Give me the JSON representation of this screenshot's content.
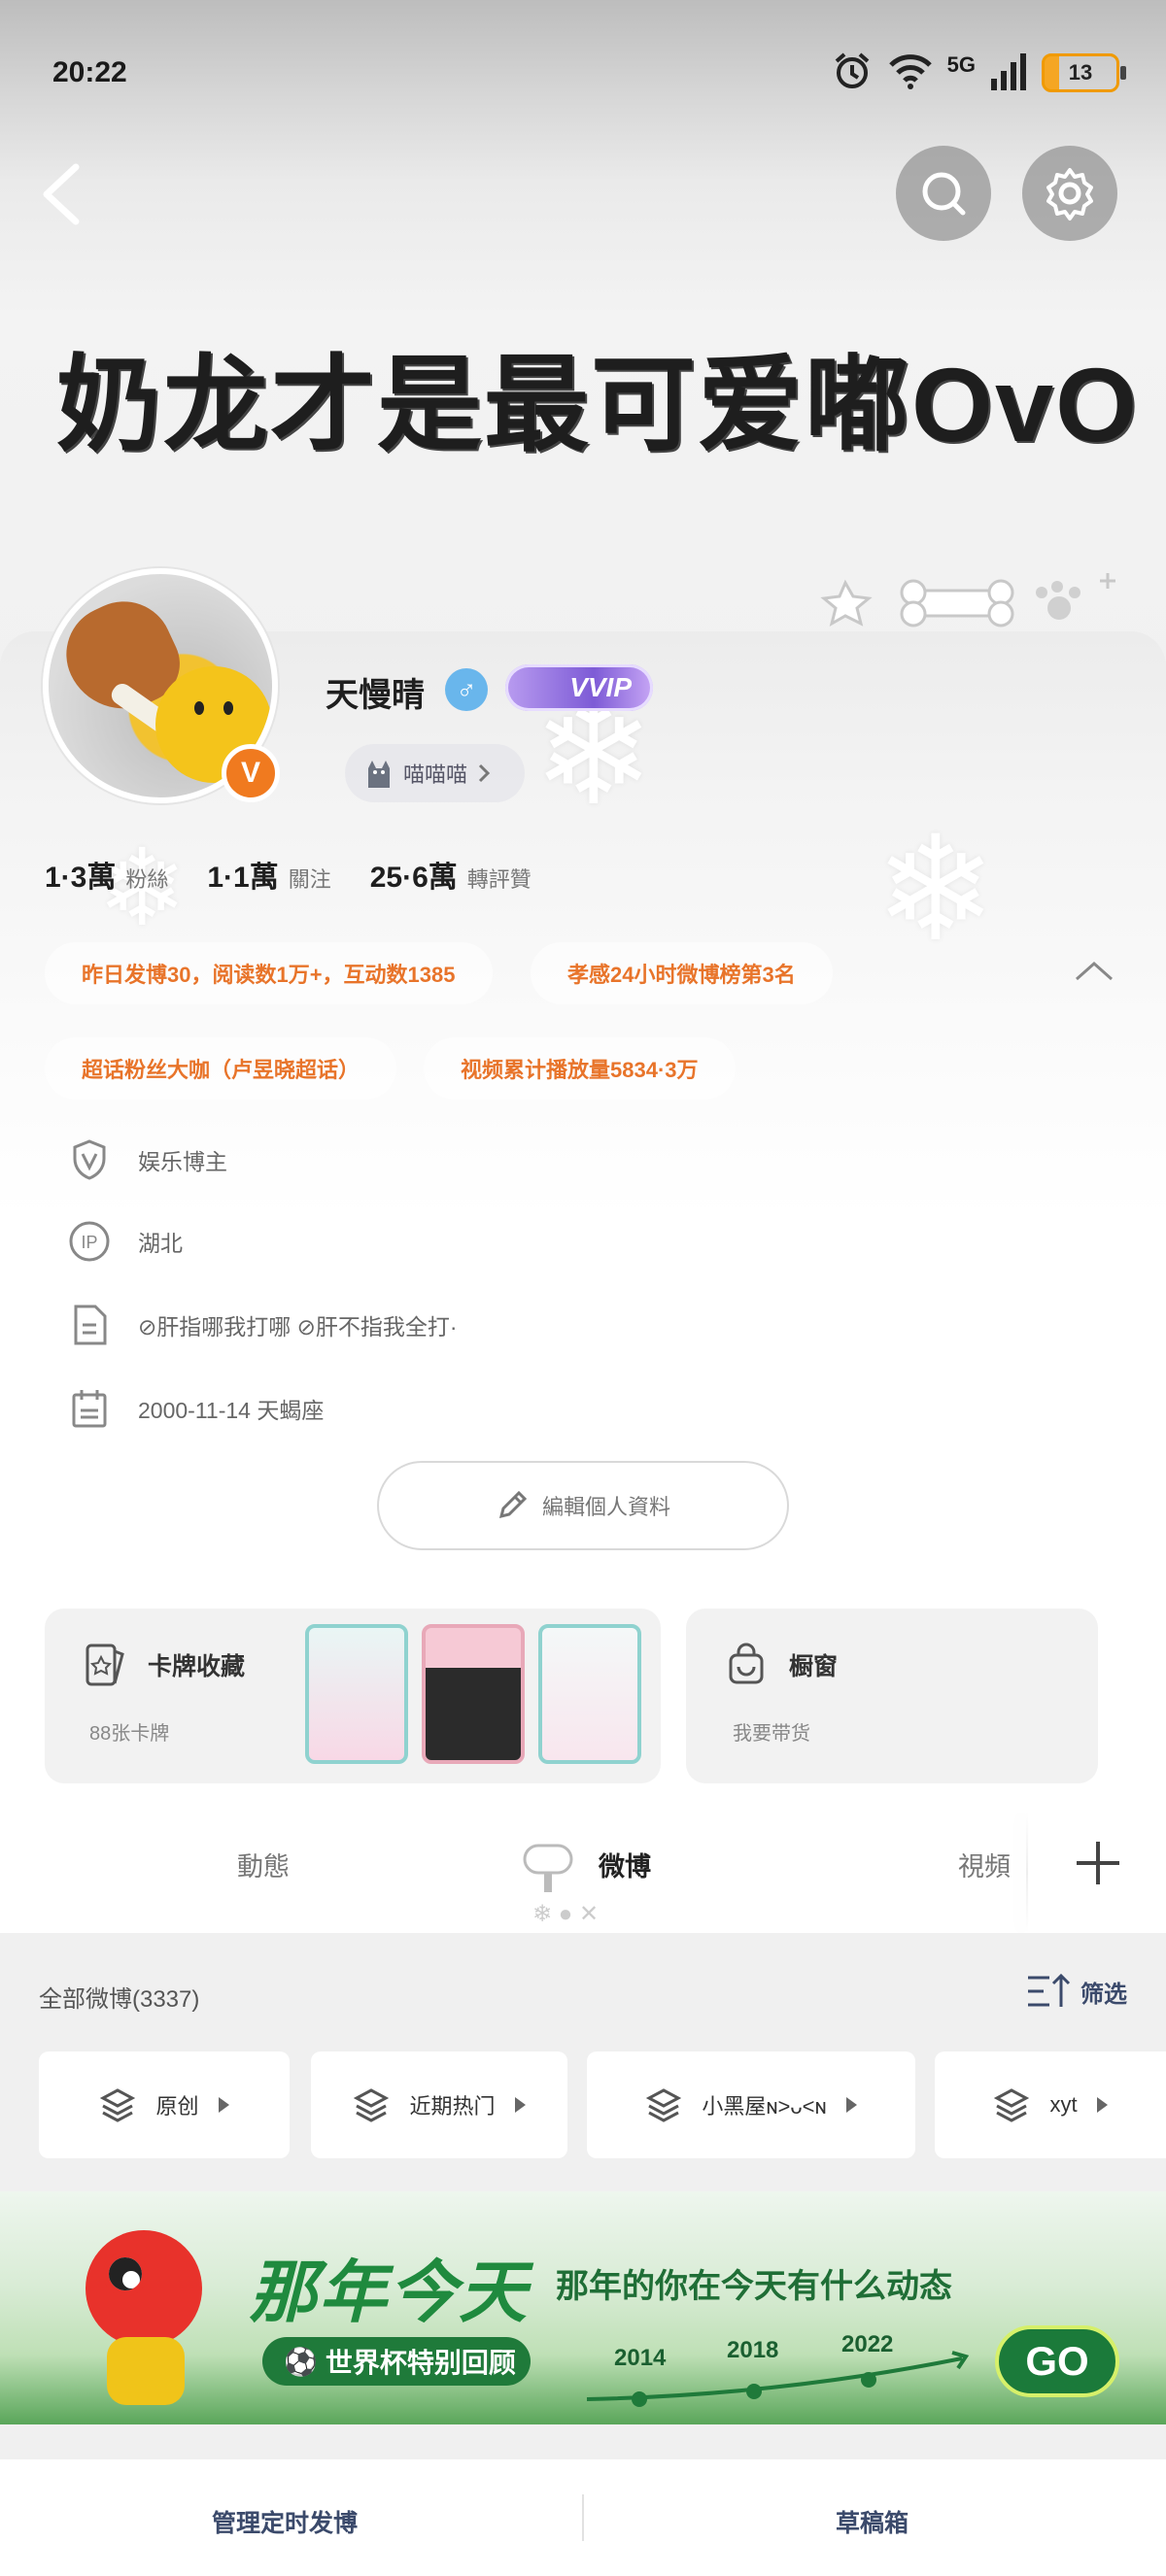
{
  "status_bar": {
    "time": "20:22",
    "network": "5G",
    "battery": "13"
  },
  "header": {
    "banner_title": "奶龙才是最可爱嘟OvO"
  },
  "profile": {
    "username": "天慢晴",
    "gender_symbol": "♂",
    "vip_badge": "VVIP",
    "verified_badge": "V",
    "tag_chip": "喵喵喵",
    "stats": [
      {
        "num": "1·3萬",
        "label": "粉絲"
      },
      {
        "num": "1·1萬",
        "label": "關注"
      },
      {
        "num": "25·6萬",
        "label": "轉評贊"
      }
    ],
    "honors": [
      "昨日发博30，阅读数1万+，互动数1385",
      "孝感24小时微博榜第3名",
      "超话粉丝大咖（卢昱晓超话）",
      "视频累计播放量5834·3万"
    ],
    "info": {
      "category": "娱乐博主",
      "ip": "湖北",
      "bio": "⊘肝指哪我打哪  ⊘肝不指我全打·",
      "birthday": "2000-11-14 天蝎座"
    },
    "ip_icon_text": "IP",
    "edit_label": "編輯個人資料"
  },
  "features": {
    "cards_title": "卡牌收藏",
    "cards_sub": "88张卡牌",
    "shop_title": "橱窗",
    "shop_sub": "我要带货"
  },
  "tabs": [
    {
      "label": "動態"
    },
    {
      "label": "微博"
    },
    {
      "label": "視頻"
    }
  ],
  "feed": {
    "count_label": "全部微博(3337)",
    "filter_label": "筛选",
    "chips": [
      "原创",
      "近期热门",
      "小黑屋ɴ>ᴗ<ɴ",
      "xyt"
    ]
  },
  "promo": {
    "title": "那年今天",
    "subtitle": "那年的你在今天有什么动态",
    "badge": "世界杯特别回顾",
    "years": [
      "2014",
      "2018",
      "2022"
    ],
    "go": "GO"
  },
  "bottom": {
    "scheduled": "管理定时发博",
    "drafts": "草稿箱"
  },
  "colors": {
    "accent_orange": "#e8742a",
    "link_blue": "#3b4a6b",
    "promo_green": "#1f8a3e"
  }
}
